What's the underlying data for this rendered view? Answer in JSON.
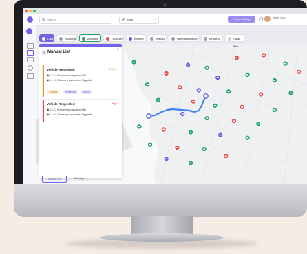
{
  "topbar": {
    "search_placeholder": "Search",
    "dropdown_value": "Now",
    "new_booking_label": "+ New booking",
    "user_name": "Admin User"
  },
  "filters": [
    {
      "label": "Cars",
      "color": "#7163e8"
    },
    {
      "label": "Bookings",
      "color": "#9aa0ad"
    },
    {
      "label": "Available",
      "color": "#22a06b"
    },
    {
      "label": "Occupied",
      "color": "#e5484d"
    },
    {
      "label": "Booked",
      "color": "#5b5fe0"
    },
    {
      "label": "Inactive",
      "color": "#9aa0ad"
    },
    {
      "label": "Need assistance",
      "color": "#9aa0ad"
    },
    {
      "label": "All filters",
      "color": "#9aa0ad"
    },
    {
      "label": "Clear filter",
      "color": "#cccccc"
    }
  ],
  "panel": {
    "title": "Manual List",
    "cards": [
      {
        "title": "Vehicle Requested",
        "badge": "Medium",
        "badge_color": "#e09a2a",
        "bar_color": "#e09a2a",
        "from_time": "13:57",
        "from_place": "Kommendantsgatan 19B",
        "to_time": "14:00",
        "to_place": "Göteborg Landvetter Flygplats",
        "tags": [
          "1 vehicle",
          "Wheelchair",
          "Sign in"
        ]
      },
      {
        "title": "Vehicle Requested",
        "badge": "High",
        "badge_color": "#e5484d",
        "bar_color": "#e5484d",
        "from_time": "13:57",
        "from_place": "Kommendantsgatan 19B",
        "to_time": "14:00",
        "to_place": "Göteborg Landvetter Flygplats"
      }
    ],
    "footer_tabs": [
      "Manual List",
      "Bookings"
    ]
  },
  "map": {
    "markers": [
      {
        "color": "#22a06b",
        "xy": [
          0.36,
          0.13
        ]
      },
      {
        "color": "#5b5fe0",
        "xy": [
          0.56,
          0.15
        ]
      },
      {
        "color": "#22a06b",
        "xy": [
          0.63,
          0.17
        ]
      },
      {
        "color": "#e5484d",
        "xy": [
          0.74,
          0.1
        ]
      },
      {
        "color": "#e5484d",
        "xy": [
          0.84,
          0.08
        ]
      },
      {
        "color": "#22a06b",
        "xy": [
          0.92,
          0.14
        ]
      },
      {
        "color": "#e5484d",
        "xy": [
          0.48,
          0.21
        ]
      },
      {
        "color": "#5b5fe0",
        "xy": [
          0.67,
          0.24
        ]
      },
      {
        "color": "#22a06b",
        "xy": [
          0.78,
          0.22
        ]
      },
      {
        "color": "#22a06b",
        "xy": [
          0.88,
          0.26
        ]
      },
      {
        "color": "#e5484d",
        "xy": [
          0.97,
          0.2
        ]
      },
      {
        "color": "#22a06b",
        "xy": [
          0.41,
          0.29
        ]
      },
      {
        "color": "#e5484d",
        "xy": [
          0.53,
          0.31
        ]
      },
      {
        "color": "#5b5fe0",
        "xy": [
          0.6,
          0.33
        ]
      },
      {
        "color": "#22a06b",
        "xy": [
          0.71,
          0.34
        ]
      },
      {
        "color": "#e5484d",
        "xy": [
          0.83,
          0.36
        ]
      },
      {
        "color": "#22a06b",
        "xy": [
          0.94,
          0.35
        ]
      },
      {
        "color": "#22a06b",
        "xy": [
          0.45,
          0.4
        ]
      },
      {
        "color": "#e5484d",
        "xy": [
          0.58,
          0.41
        ]
      },
      {
        "color": "#22a06b",
        "xy": [
          0.66,
          0.44
        ]
      },
      {
        "color": "#e5484d",
        "xy": [
          0.76,
          0.45
        ]
      },
      {
        "color": "#22a06b",
        "xy": [
          0.88,
          0.47
        ]
      },
      {
        "color": "#5b5fe0",
        "xy": [
          0.54,
          0.5
        ]
      },
      {
        "color": "#22a06b",
        "xy": [
          0.63,
          0.53
        ]
      },
      {
        "color": "#e5484d",
        "xy": [
          0.73,
          0.55
        ]
      },
      {
        "color": "#22a06b",
        "xy": [
          0.82,
          0.57
        ]
      },
      {
        "color": "#22a06b",
        "xy": [
          0.38,
          0.59
        ]
      },
      {
        "color": "#e5484d",
        "xy": [
          0.47,
          0.61
        ]
      },
      {
        "color": "#22a06b",
        "xy": [
          0.57,
          0.63
        ]
      },
      {
        "color": "#5b5fe0",
        "xy": [
          0.68,
          0.65
        ]
      },
      {
        "color": "#22a06b",
        "xy": [
          0.78,
          0.67
        ]
      },
      {
        "color": "#22a06b",
        "xy": [
          0.42,
          0.72
        ]
      },
      {
        "color": "#e5484d",
        "xy": [
          0.52,
          0.74
        ]
      },
      {
        "color": "#22a06b",
        "xy": [
          0.62,
          0.75
        ]
      },
      {
        "color": "#5b5fe0",
        "xy": [
          0.48,
          0.82
        ]
      },
      {
        "color": "#22a06b",
        "xy": [
          0.57,
          0.85
        ]
      },
      {
        "color": "#e5484d",
        "xy": [
          0.7,
          0.8
        ]
      }
    ]
  }
}
